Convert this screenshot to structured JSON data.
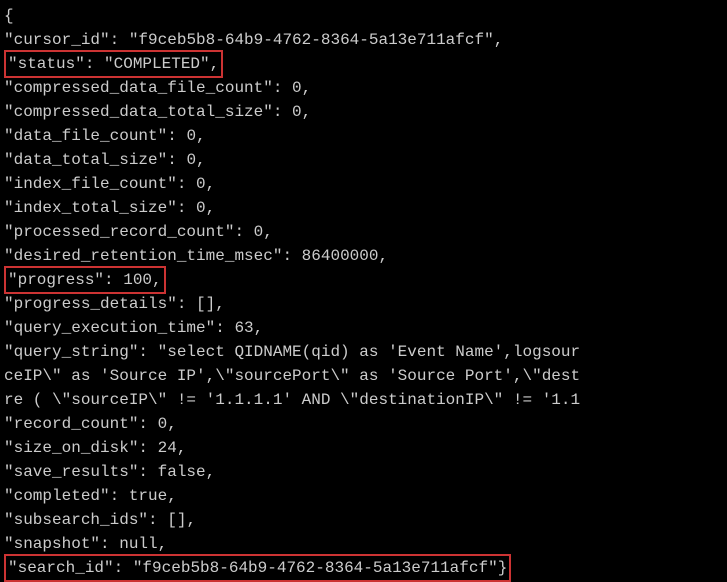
{
  "json_display": {
    "open_brace": "{",
    "cursor_id_key": "\"cursor_id\"",
    "cursor_id_val": "\"f9ceb5b8-64b9-4762-8364-5a13e711afcf\"",
    "status_key": "\"status\"",
    "status_val": "\"COMPLETED\"",
    "compressed_data_file_count_key": "\"compressed_data_file_count\"",
    "compressed_data_file_count_val": "0",
    "compressed_data_total_size_key": "\"compressed_data_total_size\"",
    "compressed_data_total_size_val": "0",
    "data_file_count_key": "\"data_file_count\"",
    "data_file_count_val": "0",
    "data_total_size_key": "\"data_total_size\"",
    "data_total_size_val": "0",
    "index_file_count_key": "\"index_file_count\"",
    "index_file_count_val": "0",
    "index_total_size_key": "\"index_total_size\"",
    "index_total_size_val": "0",
    "processed_record_count_key": "\"processed_record_count\"",
    "processed_record_count_val": "0",
    "desired_retention_time_msec_key": "\"desired_retention_time_msec\"",
    "desired_retention_time_msec_val": "86400000",
    "progress_key": "\"progress\"",
    "progress_val": "100",
    "progress_details_key": "\"progress_details\"",
    "progress_details_val": "[]",
    "query_execution_time_key": "\"query_execution_time\"",
    "query_execution_time_val": "63",
    "query_string_key": "\"query_string\"",
    "query_string_val_line1": "\"select QIDNAME(qid) as 'Event Name',logsour",
    "query_string_val_line2": "ceIP\\\" as 'Source IP',\\\"sourcePort\\\" as 'Source Port',\\\"dest",
    "query_string_val_line3": "re ( \\\"sourceIP\\\" != '1.1.1.1' AND \\\"destinationIP\\\" != '1.1",
    "record_count_key": "\"record_count\"",
    "record_count_val": "0",
    "size_on_disk_key": "\"size_on_disk\"",
    "size_on_disk_val": "24",
    "save_results_key": "\"save_results\"",
    "save_results_val": "false",
    "completed_key": "\"completed\"",
    "completed_val": "true",
    "subsearch_ids_key": "\"subsearch_ids\"",
    "subsearch_ids_val": "[]",
    "snapshot_key": "\"snapshot\"",
    "snapshot_val": "null",
    "search_id_key": "\"search_id\"",
    "search_id_val": "\"f9ceb5b8-64b9-4762-8364-5a13e711afcf\"",
    "close_brace": "}"
  }
}
